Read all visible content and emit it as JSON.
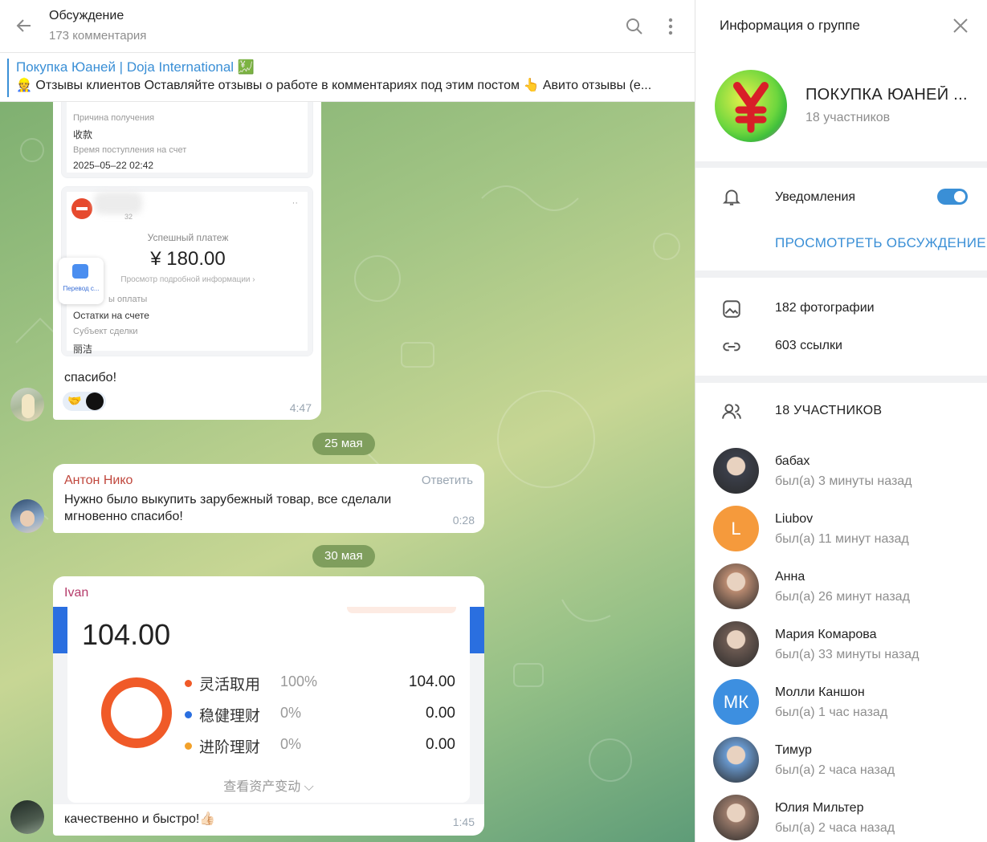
{
  "chat": {
    "title": "Обсуждение",
    "subtitle": "173 комментария",
    "pinned": {
      "title": "Покупка Юаней | Doja International 💹",
      "text": "👷 Отзывы клиентов  Оставляйте отзывы о работе в комментариях под этим постом 👆  Авито отзывы (е..."
    },
    "messages": [
      {
        "receipt1": {
          "reason_label": "Причина получения",
          "reason_value": "收款",
          "time_label": "Время поступления на счет",
          "time_value": "2025–05–22 02:42"
        },
        "receipt2": {
          "dots": "··",
          "id_suffix": "32",
          "status": "Успешный платеж",
          "amount": "¥ 180.00",
          "details_link": "Просмотр подробной информации",
          "popup_label": "Перевод с...",
          "method_label_partial": "ы оплаты",
          "method_value": "Остатки на счете",
          "party_label": "Субъект сделки",
          "party_value": "丽洁"
        },
        "text": "спасибо!",
        "time": "4:47"
      },
      {
        "author": "Антон Нико",
        "reply_label": "Ответить",
        "text": "Нужно было выкупить зарубежный товар, все сделали мгновенно спасибо!",
        "time": "0:28"
      },
      {
        "author": "Ivan",
        "screenshot": {
          "total": "104.00",
          "rows": [
            {
              "name": "灵活取用",
              "pct": "100%",
              "value": "104.00",
              "color": "#f05a28"
            },
            {
              "name": "稳健理财",
              "pct": "0%",
              "value": "0.00",
              "color": "#2a6fe0"
            },
            {
              "name": "进阶理财",
              "pct": "0%",
              "value": "0.00",
              "color": "#f2a12a"
            }
          ],
          "link": "查看资产变动"
        },
        "text": "качественно и быстро!👍🏻",
        "time": "1:45"
      }
    ],
    "dates": [
      "25 мая",
      "30 мая"
    ]
  },
  "info": {
    "title": "Информация о группе",
    "group_name": "ПОКУПКА ЮАНЕЙ ...",
    "group_sub": "18 участников",
    "notifications_label": "Уведомления",
    "view_discussion": "ПРОСМОТРЕТЬ ОБСУЖДЕНИЕ",
    "photos": "182 фотографии",
    "links": "603 ссылки",
    "members_header": "18 УЧАСТНИКОВ",
    "members": [
      {
        "name": "бабах",
        "status": "был(а) 3 минуты назад",
        "initials": "",
        "color": "#3b3f4a"
      },
      {
        "name": "Liubov",
        "status": "был(а) 11 минут назад",
        "initials": "L",
        "color": "#f59a3c"
      },
      {
        "name": "Анна",
        "status": "был(а) 26 минут назад",
        "initials": "",
        "color": "#b98a70"
      },
      {
        "name": "Мария Комарова",
        "status": "был(а) 33 минуты назад",
        "initials": "",
        "color": "#6c5a52"
      },
      {
        "name": "Молли Каншон",
        "status": "был(а) 1 час назад",
        "initials": "МК",
        "color": "#3d8fe0"
      },
      {
        "name": "Тимур",
        "status": "был(а) 2 часа назад",
        "initials": "",
        "color": "#6a9ad0"
      },
      {
        "name": "Юлия Мильтер",
        "status": "был(а) 2 часа назад",
        "initials": "",
        "color": "#9a7a6a"
      }
    ]
  }
}
